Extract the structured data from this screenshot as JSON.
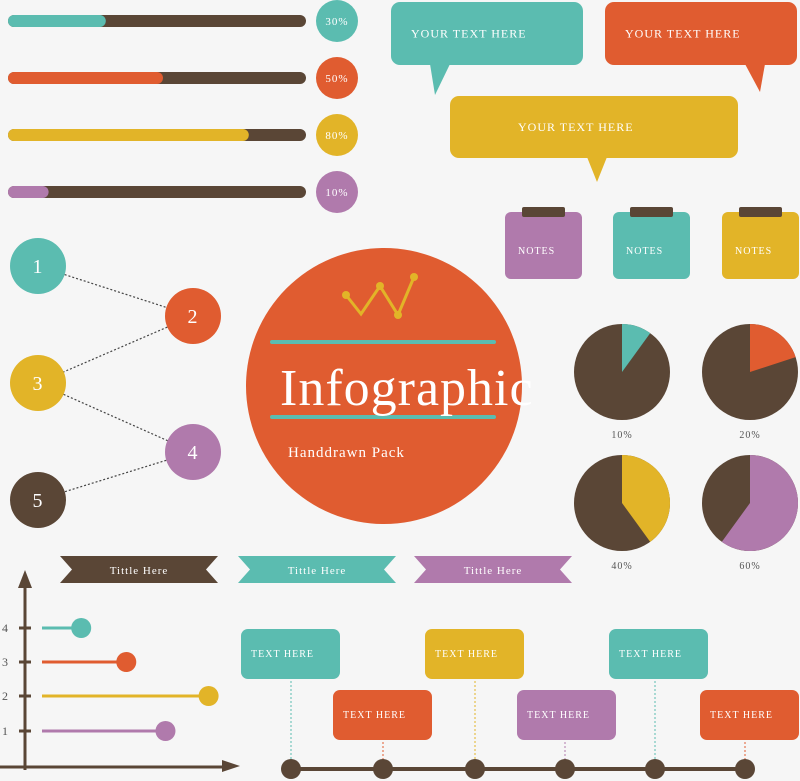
{
  "colors": {
    "teal": "#5bbcb0",
    "orange": "#e05c30",
    "yellow": "#e2b428",
    "purple": "#b07aac",
    "brown": "#5a4636",
    "background": "#f6f6f6"
  },
  "progress_bars": [
    {
      "label": "30%",
      "value": 30,
      "color": "teal"
    },
    {
      "label": "50%",
      "value": 50,
      "color": "orange"
    },
    {
      "label": "80%",
      "value": 80,
      "color": "yellow"
    },
    {
      "label": "10%",
      "value": 10,
      "color": "purple"
    }
  ],
  "speech_bubbles": [
    {
      "text": "YOUR TEXT HERE",
      "color": "teal"
    },
    {
      "text": "YOUR TEXT HERE",
      "color": "orange"
    },
    {
      "text": "YOUR TEXT HERE",
      "color": "yellow"
    }
  ],
  "notes": [
    {
      "text": "NOTES",
      "color": "purple"
    },
    {
      "text": "NOTES",
      "color": "teal"
    },
    {
      "text": "NOTES",
      "color": "yellow"
    }
  ],
  "steps": [
    {
      "label": "1",
      "color": "teal"
    },
    {
      "label": "2",
      "color": "orange"
    },
    {
      "label": "3",
      "color": "yellow"
    },
    {
      "label": "4",
      "color": "purple"
    },
    {
      "label": "5",
      "color": "brown"
    }
  ],
  "hero": {
    "title": "Infographic",
    "subtitle": "Handdrawn Pack"
  },
  "pies": [
    {
      "label": "10%",
      "value": 10,
      "color": "teal"
    },
    {
      "label": "20%",
      "value": 20,
      "color": "orange"
    },
    {
      "label": "40%",
      "value": 40,
      "color": "yellow"
    },
    {
      "label": "60%",
      "value": 60,
      "color": "purple"
    }
  ],
  "ribbons": [
    {
      "text": "Tittle Here",
      "color": "brown"
    },
    {
      "text": "Tittle Here",
      "color": "teal"
    },
    {
      "text": "Tittle Here",
      "color": "purple"
    }
  ],
  "lollipop_chart": {
    "ticks": [
      "4",
      "3",
      "2",
      "1"
    ],
    "bars": [
      {
        "tick": "4",
        "value": 0.2,
        "color": "teal"
      },
      {
        "tick": "3",
        "value": 0.43,
        "color": "orange"
      },
      {
        "tick": "2",
        "value": 0.85,
        "color": "yellow"
      },
      {
        "tick": "1",
        "value": 0.63,
        "color": "purple"
      }
    ]
  },
  "timeline": [
    {
      "text": "TEXT HERE",
      "color": "teal"
    },
    {
      "text": "TEXT HERE",
      "color": "orange"
    },
    {
      "text": "TEXT HERE",
      "color": "yellow"
    },
    {
      "text": "TEXT HERE",
      "color": "purple"
    },
    {
      "text": "TEXT HERE",
      "color": "teal"
    },
    {
      "text": "TEXT HERE",
      "color": "orange"
    }
  ]
}
